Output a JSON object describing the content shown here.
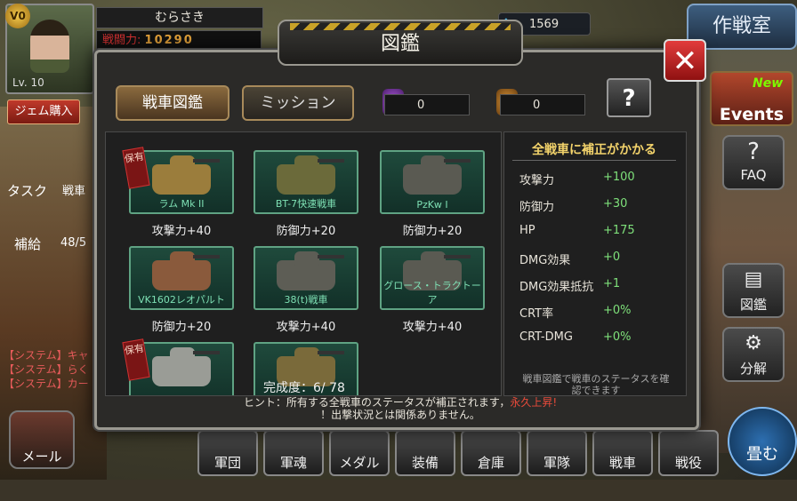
{
  "player": {
    "vip": "V0",
    "level": "Lv. 10",
    "name": "むらさき",
    "power_label": "戦闘力:",
    "power_value": "10290"
  },
  "top_resources": {
    "gems": "1569",
    "gem_icon": "gem-icon"
  },
  "buttons": {
    "gem_buy": "ジェム購入",
    "strategy_room": "作戦室",
    "events": "Events",
    "events_new": "New",
    "faq": "FAQ",
    "zukan": "図鑑",
    "bunkai": "分解",
    "mail": "メール",
    "fold": "畳む",
    "task": "タスク",
    "supply": "補給"
  },
  "left_side": {
    "task_text": "戦車",
    "supply_count": "48/5"
  },
  "chat": [
    "【システム】キャ",
    "【システム】らく",
    "【システム】カー"
  ],
  "bottom_nav": [
    "軍団",
    "軍魂",
    "メダル",
    "装備",
    "倉庫",
    "軍隊",
    "戦車",
    "戦役"
  ],
  "modal": {
    "title": "図鑑",
    "close": "✕",
    "tabs": [
      "戦車図鑑",
      "ミッション"
    ],
    "medals": {
      "purple": "0",
      "orange": "0"
    },
    "help": "?",
    "tanks": [
      {
        "name": "ラム Mk II",
        "bonus": "攻撃力+40",
        "owned": true,
        "color": "#9b7d3c"
      },
      {
        "name": "BT-7快速戦車",
        "bonus": "防御力+20",
        "owned": false,
        "color": "#6b6a3a"
      },
      {
        "name": "PzKw I",
        "bonus": "防御力+20",
        "owned": false,
        "color": "#5a5a52"
      },
      {
        "name": "VK1602レオパルト",
        "bonus": "防御力+20",
        "owned": false,
        "color": "#8a5a3c"
      },
      {
        "name": "38(t)戦車",
        "bonus": "攻撃力+40",
        "owned": false,
        "color": "#5d5d55"
      },
      {
        "name": "グロース・トラクトーア",
        "bonus": "攻撃力+40",
        "owned": false,
        "color": "#5a5a52"
      },
      {
        "name": "",
        "bonus": "",
        "owned": true,
        "color": "#9a9c96"
      },
      {
        "name": "",
        "bonus": "",
        "owned": false,
        "color": "#7a6a3a"
      }
    ],
    "owned_label": "保有",
    "completion": "完成度：6/ 78",
    "stats_title": "全戦車に補正がかかる",
    "stats": [
      {
        "label": "攻撃力",
        "value": "+100"
      },
      {
        "label": "防御力",
        "value": "+30"
      },
      {
        "label": "HP",
        "value": "+175"
      },
      {
        "label": "DMG効果",
        "value": "+0"
      },
      {
        "label": "DMG効果抵抗",
        "value": "+1"
      },
      {
        "label": "CRT率",
        "value": "+0%"
      },
      {
        "label": "CRT-DMG",
        "value": "+0%"
      }
    ],
    "stats_note": "戦車図鑑で戦車のステータスを確認できます",
    "hint_line1": "ヒント：所有する全戦車のステータスが補正されます，",
    "hint_red": "永久上昇!",
    "hint_line2": "！出撃状況とは関係ありません。"
  }
}
